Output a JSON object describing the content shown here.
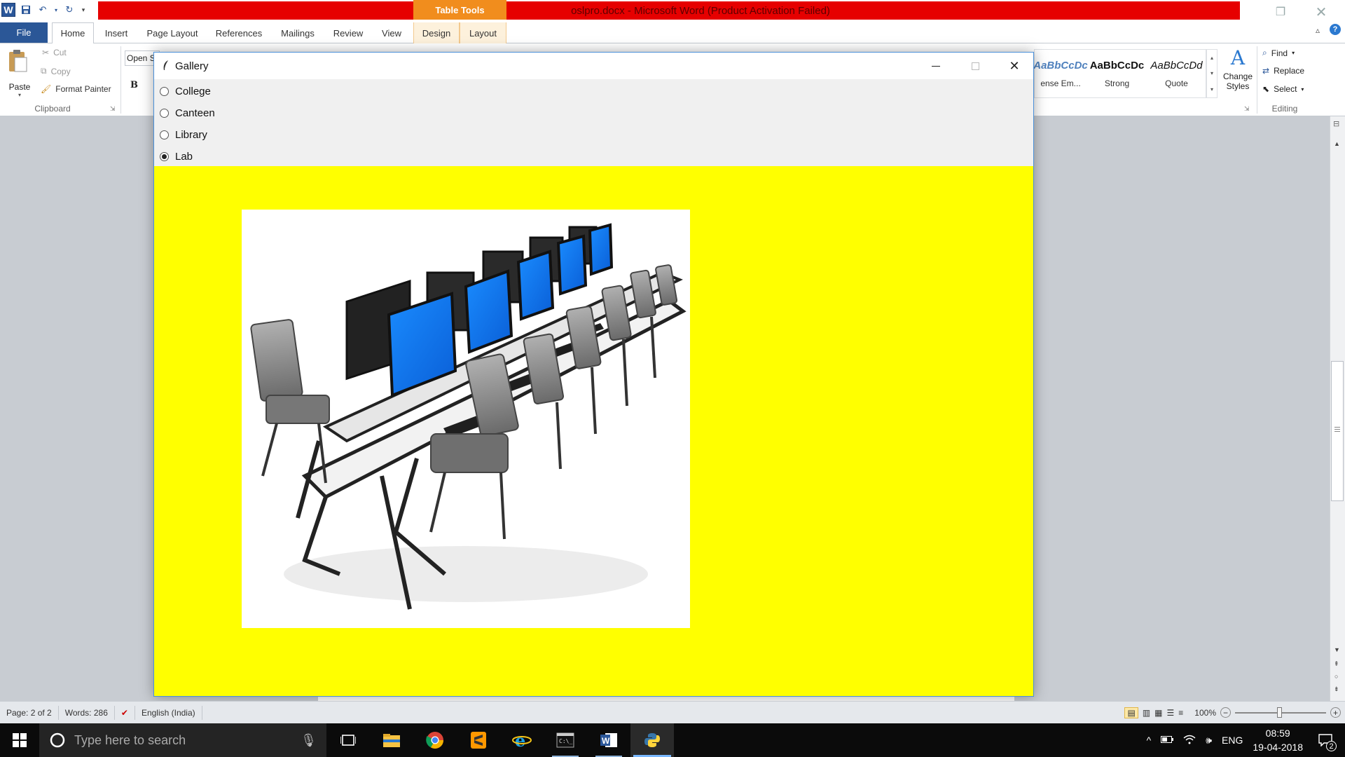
{
  "titlebar": {
    "table_tools_label": "Table Tools",
    "document_title": "oslpro.docx - Microsoft Word (Product Activation Failed)"
  },
  "tabs": {
    "file": "File",
    "home": "Home",
    "insert": "Insert",
    "page_layout": "Page Layout",
    "references": "References",
    "mailings": "Mailings",
    "review": "Review",
    "view": "View",
    "design": "Design",
    "layout": "Layout"
  },
  "ribbon": {
    "clipboard": {
      "paste": "Paste",
      "cut": "Cut",
      "copy": "Copy",
      "format_painter": "Format Painter",
      "group_label": "Clipboard"
    },
    "font": {
      "font_name_partial": "Open S",
      "bold": "B"
    },
    "styles": {
      "items": [
        {
          "sample": "AaBbCcDc",
          "name": "ense Em..."
        },
        {
          "sample": "AaBbCcDc",
          "name": "Strong"
        },
        {
          "sample": "AaBbCcDd",
          "name": "Quote"
        }
      ],
      "change_styles_line1": "Change",
      "change_styles_line2": "Styles"
    },
    "editing": {
      "find": "Find",
      "replace": "Replace",
      "select": "Select",
      "group_label": "Editing"
    }
  },
  "gallery_window": {
    "title": "Gallery",
    "options": [
      {
        "label": "College",
        "selected": false
      },
      {
        "label": "Canteen",
        "selected": false
      },
      {
        "label": "Library",
        "selected": false
      },
      {
        "label": "Lab",
        "selected": true
      }
    ],
    "panel_color": "#ffff00",
    "image_subject": "computer lab with rows of desks, monitors and chairs"
  },
  "statusbar": {
    "page": "Page: 2 of 2",
    "words": "Words: 286",
    "language": "English (India)",
    "zoom": "100%"
  },
  "taskbar": {
    "search_placeholder": "Type here to search",
    "language": "ENG",
    "time": "08:59",
    "date": "19-04-2018",
    "notification_count": "2"
  },
  "colors": {
    "word_blue": "#2b5797",
    "title_red": "#e60000",
    "table_tools_orange": "#f18d1d",
    "monitor_screen": "#0a6cf0"
  }
}
